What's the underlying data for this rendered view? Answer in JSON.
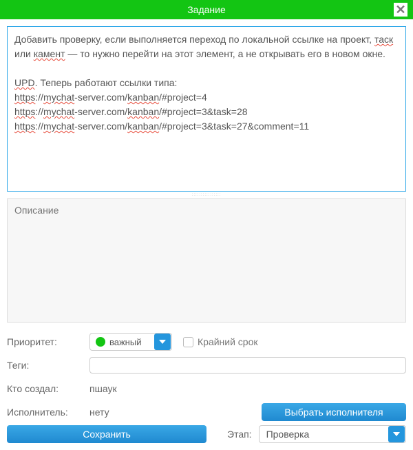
{
  "header": {
    "title": "Задание"
  },
  "title_text": "Добавить проверку, если выполняется переход по локальной ссылке на проект, таск или камент — то нужно перейти на этот элемент, а не открывать его в новом окне.\n\nUPD. Теперь работают ссылки типа:\nhttps://mychat-server.com/kanban/#project=4\nhttps://mychat-server.com/kanban/#project=3&task=28\nhttps://mychat-server.com/kanban/#project=3&task=27&comment=11",
  "description_placeholder": "Описание",
  "labels": {
    "priority": "Приоритет:",
    "deadline": "Крайний срок",
    "tags": "Теги:",
    "creator": "Кто создал:",
    "assignee": "Исполнитель:",
    "stage": "Этап:"
  },
  "priority": {
    "value": "важный",
    "color": "#13c513"
  },
  "creator": "пшаук",
  "assignee": "нету",
  "stage": {
    "value": "Проверка"
  },
  "buttons": {
    "assign": "Выбрать исполнителя",
    "save": "Сохранить"
  },
  "spellcheck_words": [
    "таск",
    "камент",
    "UPD",
    "https",
    "mychat",
    "kanban"
  ]
}
